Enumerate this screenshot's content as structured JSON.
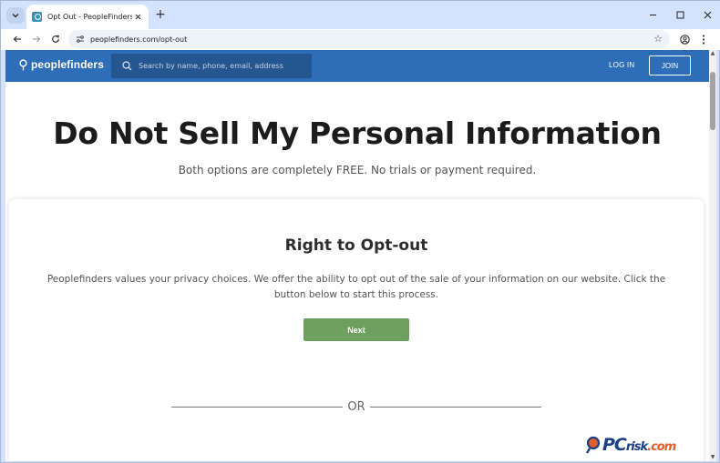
{
  "browser": {
    "tab": {
      "title": "Opt Out - PeopleFinders"
    },
    "new_tab_label": "+",
    "address_bar": {
      "url": "peoplefinders.com/opt-out"
    }
  },
  "site": {
    "logo_text": "peoplefinders",
    "search_placeholder": "Search by name, phone, email, address",
    "login_label": "LOG IN",
    "join_label": "JOIN",
    "brand_color": "#2e6db7"
  },
  "hero": {
    "title": "Do Not Sell My Personal Information",
    "subtitle": "Both options are completely FREE. No trials or payment required."
  },
  "card": {
    "title": "Right to Opt-out",
    "text": "Peoplefinders values your privacy choices. We offer the ability to opt out of the sale of your information on our website. Click the button below to start this process.",
    "button_label": "Next",
    "button_color": "#6da05e",
    "separator_label": "OR"
  },
  "watermark": {
    "main": "PC",
    "rest": "risk",
    "tld": ".com"
  }
}
